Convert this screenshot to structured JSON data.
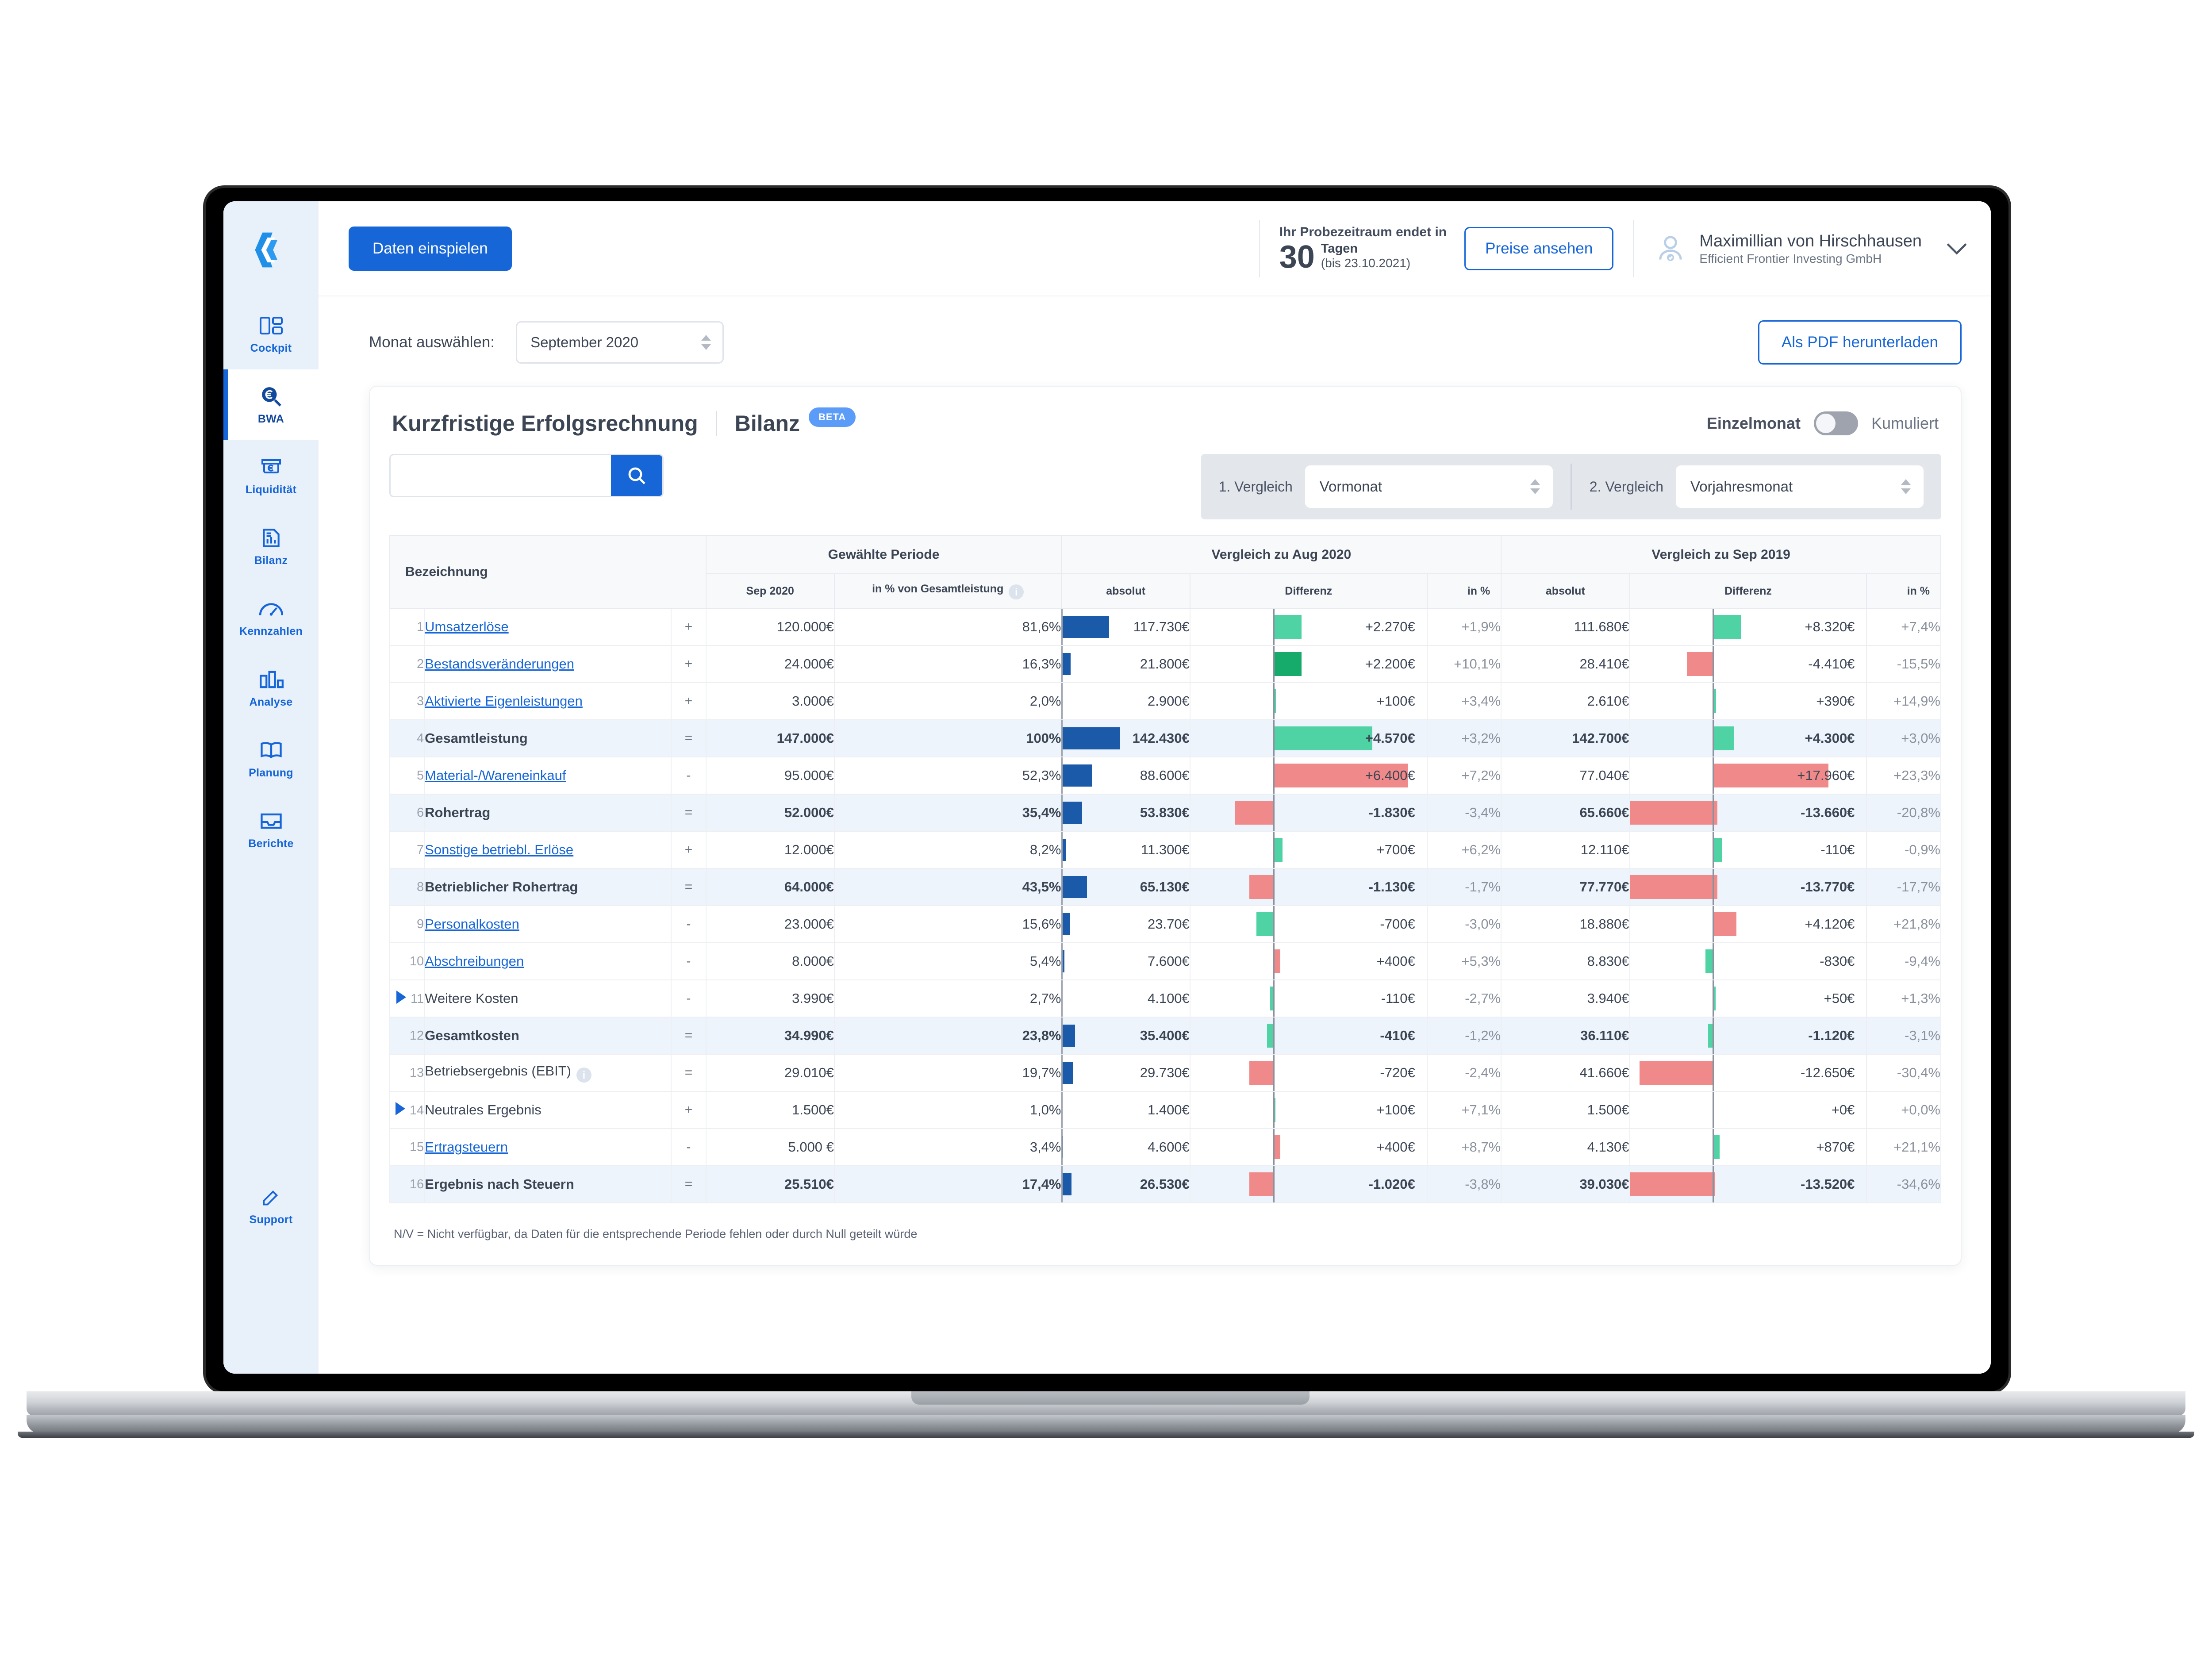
{
  "sidebar": {
    "items": [
      {
        "label": "Cockpit",
        "icon": "cockpit-icon",
        "active": false
      },
      {
        "label": "BWA",
        "icon": "magnifier-euro-icon",
        "active": true
      },
      {
        "label": "Liquidität",
        "icon": "cash-euro-icon",
        "active": false
      },
      {
        "label": "Bilanz",
        "icon": "report-icon",
        "active": false
      },
      {
        "label": "Kennzahlen",
        "icon": "gauge-icon",
        "active": false
      },
      {
        "label": "Analyse",
        "icon": "bars-icon",
        "active": false
      },
      {
        "label": "Planung",
        "icon": "book-icon",
        "active": false
      },
      {
        "label": "Berichte",
        "icon": "tray-icon",
        "active": false
      }
    ],
    "support": {
      "label": "Support",
      "icon": "pencil-icon"
    }
  },
  "topbar": {
    "import_button": "Daten einspielen",
    "trial_line1": "Ihr Probezeitraum endet in",
    "trial_days": "30",
    "trial_days_unit": "Tagen",
    "trial_until": "(bis 23.10.2021)",
    "prices_button": "Preise ansehen",
    "user_name": "Maximillian von Hirschhausen",
    "user_org": "Efficient Frontier Investing GmbH"
  },
  "controls": {
    "month_label": "Monat auswählen:",
    "month_value": "September 2020",
    "download_button": "Als PDF herunterladen"
  },
  "card": {
    "title": "Kurzfristige Erfolgsrechnung",
    "subtitle": "Bilanz",
    "beta_badge": "BETA",
    "toggle_left": "Einzelmonat",
    "toggle_right": "Kumuliert",
    "search_value": "",
    "search_placeholder": "",
    "compare1_label": "1. Vergleich",
    "compare1_value": "Vormonat",
    "compare2_label": "2. Vergleich",
    "compare2_value": "Vorjahresmonat",
    "footnote": "N/V = Nicht verfügbar, da Daten für die entsprechende Periode fehlen oder durch Null geteilt würde"
  },
  "table": {
    "headers": {
      "bezeichnung": "Bezeichnung",
      "group_period": "Gewählte Periode",
      "group_cmp1": "Vergleich zu Aug 2020",
      "group_cmp2": "Vergleich zu Sep 2019",
      "period_col": "Sep 2020",
      "percent_col": "in % von Gesamtleistung",
      "absolut": "absolut",
      "differenz": "Differenz",
      "in_prozent": "in %"
    },
    "rows": [
      {
        "no": "1",
        "label": "Umsatzerlöse",
        "link": true,
        "bold": false,
        "expand": false,
        "op": "+",
        "value": "120.000€",
        "pct": "81,6%",
        "pct_num": 81.6,
        "c1_abs": "117.730€",
        "c1_diff": "+2.270€",
        "c1_pct": "+1,9%",
        "c1_bar": {
          "side": "right",
          "w": 12,
          "color": "green"
        },
        "c2_abs": "111.680€",
        "c2_diff": "+8.320€",
        "c2_pct": "+7,4%",
        "c2_bar": {
          "side": "right",
          "w": 12,
          "color": "green"
        }
      },
      {
        "no": "2",
        "label": "Bestandsveränderungen",
        "link": true,
        "bold": false,
        "expand": false,
        "op": "+",
        "value": "24.000€",
        "pct": "16,3%",
        "pct_num": 16.3,
        "c1_abs": "21.800€",
        "c1_diff": "+2.200€",
        "c1_pct": "+10,1%",
        "c1_bar": {
          "side": "right",
          "w": 12,
          "color": "green-dark"
        },
        "c2_abs": "28.410€",
        "c2_diff": "-4.410€",
        "c2_pct": "-15,5%",
        "c2_bar": {
          "side": "left",
          "w": 11,
          "color": "red"
        }
      },
      {
        "no": "3",
        "label": "Aktivierte Eigenleistungen",
        "link": true,
        "bold": false,
        "expand": false,
        "op": "+",
        "value": "3.000€",
        "pct": "2,0%",
        "pct_num": 2.0,
        "c1_abs": "2.900€",
        "c1_diff": "+100€",
        "c1_pct": "+3,4%",
        "c1_bar": {
          "side": "right",
          "w": 1.2,
          "color": "green"
        },
        "c2_abs": "2.610€",
        "c2_diff": "+390€",
        "c2_pct": "+14,9%",
        "c2_bar": {
          "side": "right",
          "w": 1.5,
          "color": "green"
        }
      },
      {
        "no": "4",
        "label": "Gesamtleistung",
        "link": false,
        "bold": true,
        "expand": false,
        "op": "=",
        "value": "147.000€",
        "pct": "100%",
        "pct_num": 100,
        "c1_abs": "142.430€",
        "c1_diff": "+4.570€",
        "c1_pct": "+3,2%",
        "c1_bar": {
          "side": "right",
          "w": 42,
          "color": "green"
        },
        "c2_abs": "142.700€",
        "c2_diff": "+4.300€",
        "c2_pct": "+3,0%",
        "c2_bar": {
          "side": "right",
          "w": 9,
          "color": "green"
        }
      },
      {
        "no": "5",
        "label": "Material-/Wareneinkauf",
        "link": true,
        "bold": false,
        "expand": false,
        "op": "-",
        "value": "95.000€",
        "pct": "52,3%",
        "pct_num": 52.3,
        "c1_abs": "88.600€",
        "c1_diff": "+6.400€",
        "c1_pct": "+7,2%",
        "c1_bar": {
          "side": "right",
          "w": 57,
          "color": "red"
        },
        "c2_abs": "77.040€",
        "c2_diff": "+17.960€",
        "c2_pct": "+23,3%",
        "c2_bar": {
          "side": "right",
          "w": 49,
          "color": "red"
        }
      },
      {
        "no": "6",
        "label": "Rohertrag",
        "link": false,
        "bold": true,
        "expand": false,
        "op": "=",
        "value": "52.000€",
        "pct": "35,4%",
        "pct_num": 35.4,
        "c1_abs": "53.830€",
        "c1_diff": "-1.830€",
        "c1_pct": "-3,4%",
        "c1_bar": {
          "side": "left",
          "w": 16,
          "color": "red"
        },
        "c2_abs": "65.660€",
        "c2_diff": "-13.660€",
        "c2_pct": "-20,8%",
        "c2_bar": {
          "side": "left",
          "w": 37,
          "color": "red"
        }
      },
      {
        "no": "7",
        "label": "Sonstige betriebl. Erlöse",
        "link": true,
        "bold": false,
        "expand": false,
        "op": "+",
        "value": "12.000€",
        "pct": "8,2%",
        "pct_num": 8.2,
        "c1_abs": "11.300€",
        "c1_diff": "+700€",
        "c1_pct": "+6,2%",
        "c1_bar": {
          "side": "right",
          "w": 4,
          "color": "green"
        },
        "c2_abs": "12.110€",
        "c2_diff": "-110€",
        "c2_pct": "-0,9%",
        "c2_bar": {
          "side": "right",
          "w": 4,
          "color": "green"
        }
      },
      {
        "no": "8",
        "label": "Betrieblicher Rohertrag",
        "link": false,
        "bold": true,
        "expand": false,
        "op": "=",
        "value": "64.000€",
        "pct": "43,5%",
        "pct_num": 43.5,
        "c1_abs": "65.130€",
        "c1_diff": "-1.130€",
        "c1_pct": "-1,7%",
        "c1_bar": {
          "side": "left",
          "w": 10,
          "color": "red"
        },
        "c2_abs": "77.770€",
        "c2_diff": "-13.770€",
        "c2_pct": "-17,7%",
        "c2_bar": {
          "side": "left",
          "w": 37,
          "color": "red"
        }
      },
      {
        "no": "9",
        "label": "Personalkosten",
        "link": true,
        "bold": false,
        "expand": false,
        "op": "-",
        "value": "23.000€",
        "pct": "15,6%",
        "pct_num": 15.6,
        "c1_abs": "23.70€",
        "c1_diff": "-700€",
        "c1_pct": "-3,0%",
        "c1_bar": {
          "side": "left",
          "w": 7,
          "color": "green"
        },
        "c2_abs": "18.880€",
        "c2_diff": "+4.120€",
        "c2_pct": "+21,8%",
        "c2_bar": {
          "side": "right",
          "w": 10,
          "color": "red"
        }
      },
      {
        "no": "10",
        "label": "Abschreibungen",
        "link": true,
        "bold": false,
        "expand": false,
        "op": "-",
        "value": "8.000€",
        "pct": "5,4%",
        "pct_num": 5.4,
        "c1_abs": "7.600€",
        "c1_diff": "+400€",
        "c1_pct": "+5,3%",
        "c1_bar": {
          "side": "right",
          "w": 3,
          "color": "red"
        },
        "c2_abs": "8.830€",
        "c2_diff": "-830€",
        "c2_pct": "-9,4%",
        "c2_bar": {
          "side": "left",
          "w": 3,
          "color": "green"
        }
      },
      {
        "no": "11",
        "label": "Weitere Kosten",
        "link": false,
        "bold": false,
        "expand": true,
        "op": "-",
        "value": "3.990€",
        "pct": "2,7%",
        "pct_num": 2.7,
        "c1_abs": "4.100€",
        "c1_diff": "-110€",
        "c1_pct": "-2,7%",
        "c1_bar": {
          "side": "left",
          "w": 1.2,
          "color": "green"
        },
        "c2_abs": "3.940€",
        "c2_diff": "+50€",
        "c2_pct": "+1,3%",
        "c2_bar": {
          "side": "right",
          "w": 1.2,
          "color": "green"
        }
      },
      {
        "no": "12",
        "label": "Gesamtkosten",
        "link": false,
        "bold": true,
        "expand": false,
        "op": "=",
        "value": "34.990€",
        "pct": "23,8%",
        "pct_num": 23.8,
        "c1_abs": "35.400€",
        "c1_diff": "-410€",
        "c1_pct": "-1,2%",
        "c1_bar": {
          "side": "left",
          "w": 2.5,
          "color": "green"
        },
        "c2_abs": "36.110€",
        "c2_diff": "-1.120€",
        "c2_pct": "-3,1%",
        "c2_bar": {
          "side": "left",
          "w": 2,
          "color": "green"
        }
      },
      {
        "no": "13",
        "label": "Betriebsergebnis (EBIT)",
        "link": false,
        "bold": false,
        "expand": false,
        "info": true,
        "op": "=",
        "value": "29.010€",
        "pct": "19,7%",
        "pct_num": 19.7,
        "c1_abs": "29.730€",
        "c1_diff": "-720€",
        "c1_pct": "-2,4%",
        "c1_bar": {
          "side": "left",
          "w": 10,
          "color": "red"
        },
        "c2_abs": "41.660€",
        "c2_diff": "-12.650€",
        "c2_pct": "-30,4%",
        "c2_bar": {
          "side": "left",
          "w": 31,
          "color": "red"
        }
      },
      {
        "no": "14",
        "label": "Neutrales Ergebnis",
        "link": false,
        "bold": false,
        "expand": true,
        "op": "+",
        "value": "1.500€",
        "pct": "1,0%",
        "pct_num": 1.0,
        "c1_abs": "1.400€",
        "c1_diff": "+100€",
        "c1_pct": "+7,1%",
        "c1_bar": {
          "side": "right",
          "w": 1,
          "color": "green"
        },
        "c2_abs": "1.500€",
        "c2_diff": "+0€",
        "c2_pct": "+0,0%",
        "c2_bar": {
          "side": "right",
          "w": 0,
          "color": "green"
        }
      },
      {
        "no": "15",
        "label": "Ertragsteuern",
        "link": true,
        "bold": false,
        "expand": false,
        "op": "-",
        "value": "5.000 €",
        "pct": "3,4%",
        "pct_num": 3.4,
        "c1_abs": "4.600€",
        "c1_diff": "+400€",
        "c1_pct": "+8,7%",
        "c1_bar": {
          "side": "right",
          "w": 3,
          "color": "red"
        },
        "c2_abs": "4.130€",
        "c2_diff": "+870€",
        "c2_pct": "+21,1%",
        "c2_bar": {
          "side": "right",
          "w": 3,
          "color": "green"
        }
      },
      {
        "no": "16",
        "label": "Ergebnis nach Steuern",
        "link": false,
        "bold": true,
        "expand": false,
        "op": "=",
        "value": "25.510€",
        "pct": "17,4%",
        "pct_num": 17.4,
        "c1_abs": "26.530€",
        "c1_diff": "-1.020€",
        "c1_pct": "-3,8%",
        "c1_bar": {
          "side": "left",
          "w": 10,
          "color": "red"
        },
        "c2_abs": "39.030€",
        "c2_diff": "-13.520€",
        "c2_pct": "-34,6%",
        "c2_bar": {
          "side": "left",
          "w": 36,
          "color": "red"
        }
      }
    ]
  },
  "colors": {
    "brand_blue": "#1766d8",
    "bar_blue": "#1a5aa8",
    "green": "#4fd2a4",
    "green_dark": "#17ab6b",
    "red": "#f08a8a",
    "sidebar_bg": "#e8f0fa",
    "alt_row": "#eef4fc"
  }
}
